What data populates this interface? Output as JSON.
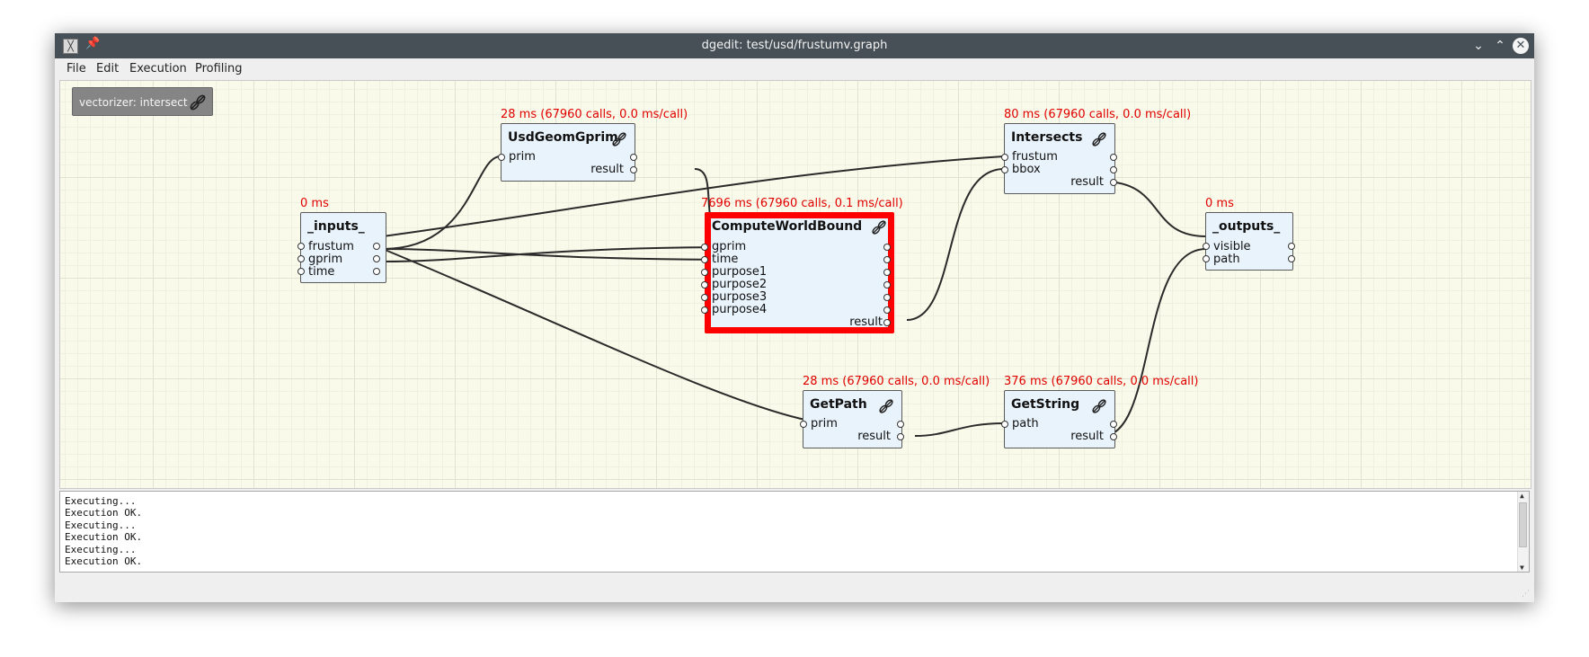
{
  "window": {
    "title": "dgedit: test/usd/frustumv.graph"
  },
  "menu": {
    "items": [
      "File",
      "Edit",
      "Execution",
      "Profiling"
    ]
  },
  "vectorizer_label": "vectorizer: intersect",
  "nodes": {
    "inputs": {
      "title": "_inputs_",
      "timing": "0 ms",
      "ports": [
        "frustum",
        "gprim",
        "time"
      ]
    },
    "usdgeomgprim": {
      "title": "UsdGeomGprim",
      "timing": "28 ms (67960 calls, 0.0 ms/call)",
      "in": [
        "prim"
      ],
      "out": "result"
    },
    "computeworldbound": {
      "title": "ComputeWorldBound",
      "timing": "7696 ms (67960 calls, 0.1 ms/call)",
      "in": [
        "gprim",
        "time",
        "purpose1",
        "purpose2",
        "purpose3",
        "purpose4"
      ],
      "out": "result"
    },
    "intersects": {
      "title": "Intersects",
      "timing": "80 ms (67960 calls, 0.0 ms/call)",
      "in": [
        "frustum",
        "bbox"
      ],
      "out": "result"
    },
    "outputs": {
      "title": "_outputs_",
      "timing": "0 ms",
      "ports": [
        "visible",
        "path"
      ]
    },
    "getpath": {
      "title": "GetPath",
      "timing": "28 ms (67960 calls, 0.0 ms/call)",
      "in": [
        "prim"
      ],
      "out": "result"
    },
    "getstring": {
      "title": "GetString",
      "timing": "376 ms (67960 calls, 0.0 ms/call)",
      "in": [
        "path"
      ],
      "out": "result"
    }
  },
  "console": [
    "Executing...",
    "Execution OK.",
    "Executing...",
    "Execution OK.",
    "Executing...",
    "Execution OK."
  ],
  "colors": {
    "highlight": "#ff0000",
    "timing": "#e00000",
    "node_fill": "#e9f3fc",
    "titlebar": "#475057"
  }
}
